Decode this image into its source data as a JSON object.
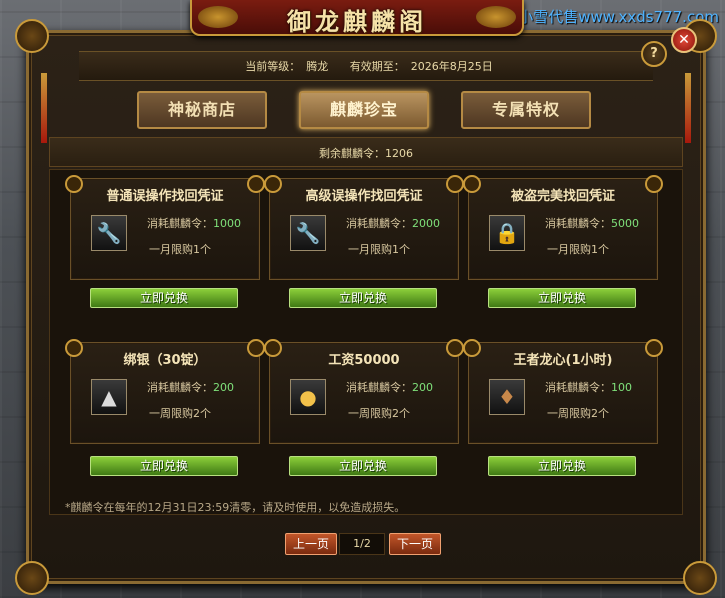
{
  "watermark": "小雪代售www.xxds777.com",
  "window": {
    "title": "御龙麒麟阁",
    "help_label": "?",
    "close_label": "✕"
  },
  "header": {
    "level_label": "当前等级：",
    "level_value": "腾龙",
    "expiry_label": "有效期至：",
    "expiry_value": "2026年8月25日"
  },
  "tabs": [
    {
      "label": "神秘商店"
    },
    {
      "label": "麒麟珍宝"
    },
    {
      "label": "专属特权"
    }
  ],
  "active_tab": "麒麟珍宝",
  "remaining": {
    "label": "剩余麒麟令：",
    "value": "1206"
  },
  "items": [
    {
      "title": "普通误操作找回凭证",
      "icon": "wrench-icon",
      "cost_label": "消耗麒麟令：",
      "cost": "1000",
      "limit": "一月限购1个",
      "button": "立即兑换"
    },
    {
      "title": "高级误操作找回凭证",
      "icon": "wrench-icon",
      "cost_label": "消耗麒麟令：",
      "cost": "2000",
      "limit": "一月限购1个",
      "button": "立即兑换"
    },
    {
      "title": "被盗完美找回凭证",
      "icon": "lock-icon",
      "cost_label": "消耗麒麟令：",
      "cost": "5000",
      "limit": "一月限购1个",
      "button": "立即兑换"
    },
    {
      "title": "绑银（30锭）",
      "icon": "silver-ingot-icon",
      "cost_label": "消耗麒麟令：",
      "cost": "200",
      "limit": "一周限购2个",
      "button": "立即兑换"
    },
    {
      "title": "工资50000",
      "icon": "gold-coins-icon",
      "cost_label": "消耗麒麟令：",
      "cost": "200",
      "limit": "一周限购2个",
      "button": "立即兑换"
    },
    {
      "title": "王者龙心(1小时)",
      "icon": "dragon-heart-icon",
      "cost_label": "消耗麒麟令：",
      "cost": "100",
      "limit": "一周限购2个",
      "button": "立即兑换"
    }
  ],
  "notice": "*麒麟令在每年的12月31日23:59清零，请及时使用，以免造成损失。",
  "pager": {
    "prev_label": "上一页",
    "page": "1/2",
    "next_label": "下一页"
  },
  "colors": {
    "accent_gold": "#c99a3a",
    "cost_value": "#7fe07a",
    "exchange_button": "#5fa824",
    "page_button": "#a8401a"
  }
}
